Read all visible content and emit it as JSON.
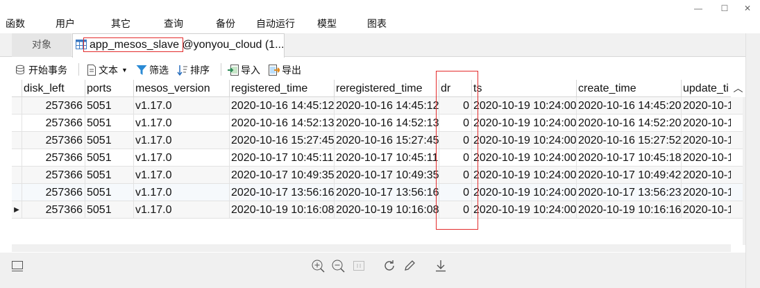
{
  "menu": {
    "items": [
      "函数",
      "用户",
      "其它",
      "查询",
      "备份",
      "自动运行",
      "模型",
      "图表"
    ]
  },
  "tabs": {
    "object_label": "对象",
    "table_tab_label": "app_mesos_slave @yonyou_cloud (1..."
  },
  "toolbar": {
    "begin_transaction": "开始事务",
    "text": "文本",
    "filter": "筛选",
    "sort": "排序",
    "import": "导入",
    "export": "导出"
  },
  "grid": {
    "columns": [
      "disk_left",
      "ports",
      "mesos_version",
      "registered_time",
      "reregistered_time",
      "dr",
      "ts",
      "create_time",
      "update_ti"
    ],
    "rows": [
      [
        "257366",
        "5051",
        "v1.17.0",
        "2020-10-16 14:45:12",
        "2020-10-16 14:45:12",
        "0",
        "2020-10-19 10:24:00",
        "2020-10-16 14:45:20",
        "2020-10-1"
      ],
      [
        "257366",
        "5051",
        "v1.17.0",
        "2020-10-16 14:52:13",
        "2020-10-16 14:52:13",
        "0",
        "2020-10-19 10:24:00",
        "2020-10-16 14:52:20",
        "2020-10-1"
      ],
      [
        "257366",
        "5051",
        "v1.17.0",
        "2020-10-16 15:27:45",
        "2020-10-16 15:27:45",
        "0",
        "2020-10-19 10:24:00",
        "2020-10-16 15:27:52",
        "2020-10-1"
      ],
      [
        "257366",
        "5051",
        "v1.17.0",
        "2020-10-17 10:45:11",
        "2020-10-17 10:45:11",
        "0",
        "2020-10-19 10:24:00",
        "2020-10-17 10:45:18",
        "2020-10-1"
      ],
      [
        "257366",
        "5051",
        "v1.17.0",
        "2020-10-17 10:49:35",
        "2020-10-17 10:49:35",
        "0",
        "2020-10-19 10:24:00",
        "2020-10-17 10:49:42",
        "2020-10-1"
      ],
      [
        "257366",
        "5051",
        "v1.17.0",
        "2020-10-17 13:56:16",
        "2020-10-17 13:56:16",
        "0",
        "2020-10-19 10:24:00",
        "2020-10-17 13:56:23",
        "2020-10-1"
      ],
      [
        "257366",
        "5051",
        "v1.17.0",
        "2020-10-19 10:16:08",
        "2020-10-19 10:16:08",
        "0",
        "2020-10-19 10:24:00",
        "2020-10-19 10:16:16",
        "2020-10-1"
      ]
    ],
    "current_row_marker": "▶",
    "scroll_up_glyph": "︿"
  },
  "window": {
    "minimize_glyph": "—",
    "maximize_glyph": "☐",
    "close_glyph": "✕"
  },
  "colors": {
    "highlight_red": "#e32b2b",
    "filter_blue": "#2a8ad4",
    "sort_blue": "#2a6fbd",
    "import_green": "#2e8b57",
    "export_orange": "#e08a1e"
  },
  "icons": [
    "transaction-icon",
    "text-icon",
    "filter-icon",
    "sort-icon",
    "import-icon",
    "export-icon",
    "form-view-icon",
    "zoom-in-icon",
    "zoom-out-icon",
    "actual-size-icon",
    "refresh-icon",
    "edit-icon",
    "download-icon"
  ]
}
